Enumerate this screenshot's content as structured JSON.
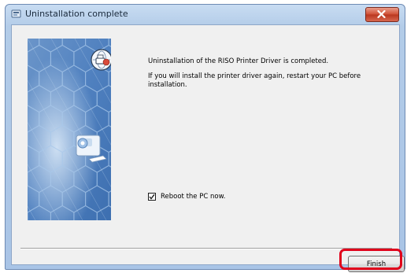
{
  "window": {
    "title": "Uninstallation complete",
    "icon": "installer-icon",
    "close_icon": "close-icon"
  },
  "banner": {
    "image": "hexagon-banner-with-printer",
    "badge_icon": "globe-printer-icon",
    "colors": {
      "primary": "#4f82c2",
      "light": "#a9c8ea"
    }
  },
  "message": {
    "line1": "Uninstallation of the RISO Printer Driver is completed.",
    "line2": "If you will install the printer driver again, restart your PC before installation."
  },
  "reboot": {
    "label": "Reboot the PC now.",
    "checked": true
  },
  "buttons": {
    "finish_label": "Finish"
  },
  "colors": {
    "highlight": "#e0001b",
    "close_button": "#cf4d33"
  }
}
